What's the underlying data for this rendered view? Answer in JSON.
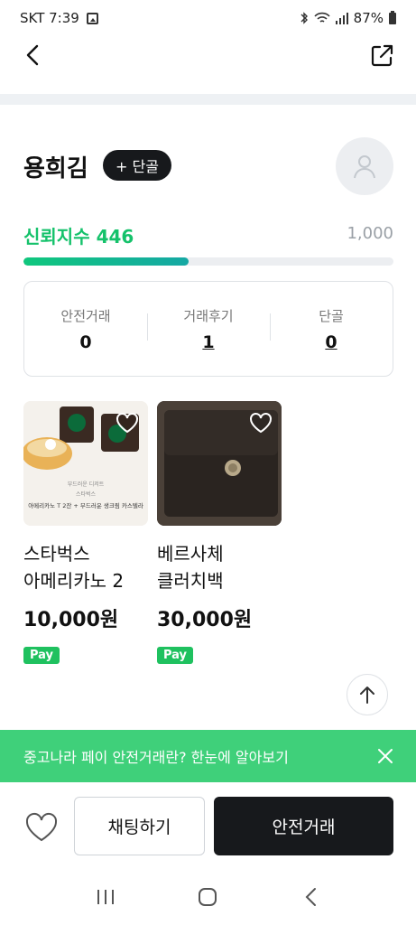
{
  "status_bar": {
    "carrier_time": "SKT 7:39",
    "battery": "87%"
  },
  "header": {
    "back_icon": "chevron-left-icon",
    "share_icon": "share-external-icon"
  },
  "profile": {
    "name": "용희김",
    "follow_label": "+ 단골",
    "avatar_icon": "user-icon"
  },
  "trust": {
    "label": "신뢰지수 446",
    "max": "1,000",
    "score": 446,
    "max_value": 1000,
    "accent": "#15c26b"
  },
  "stats": [
    {
      "label": "안전거래",
      "value": "0"
    },
    {
      "label": "거래후기",
      "value": "1"
    },
    {
      "label": "단골",
      "value": "0"
    }
  ],
  "products": [
    {
      "title": "스타벅스 아메리카노 2 카...",
      "price": "10,000원",
      "badge": "Pay",
      "thumb_caption_1": "부드러운 디저트",
      "thumb_caption_2": "스타벅스",
      "thumb_caption_3": "아메리카노 T 2잔 + 부드러운 생크림 카스텔라"
    },
    {
      "title": "베르사체 클러치백",
      "price": "30,000원",
      "badge": "Pay"
    }
  ],
  "promo": {
    "text": "중고나라 페이 안전거래란? 한눈에 알아보기"
  },
  "bottom": {
    "chat_label": "채팅하기",
    "safe_label": "안전거래"
  },
  "colors": {
    "brand_green": "#3fd07a",
    "dark": "#17191c",
    "pay_green": "#1fc15f"
  }
}
